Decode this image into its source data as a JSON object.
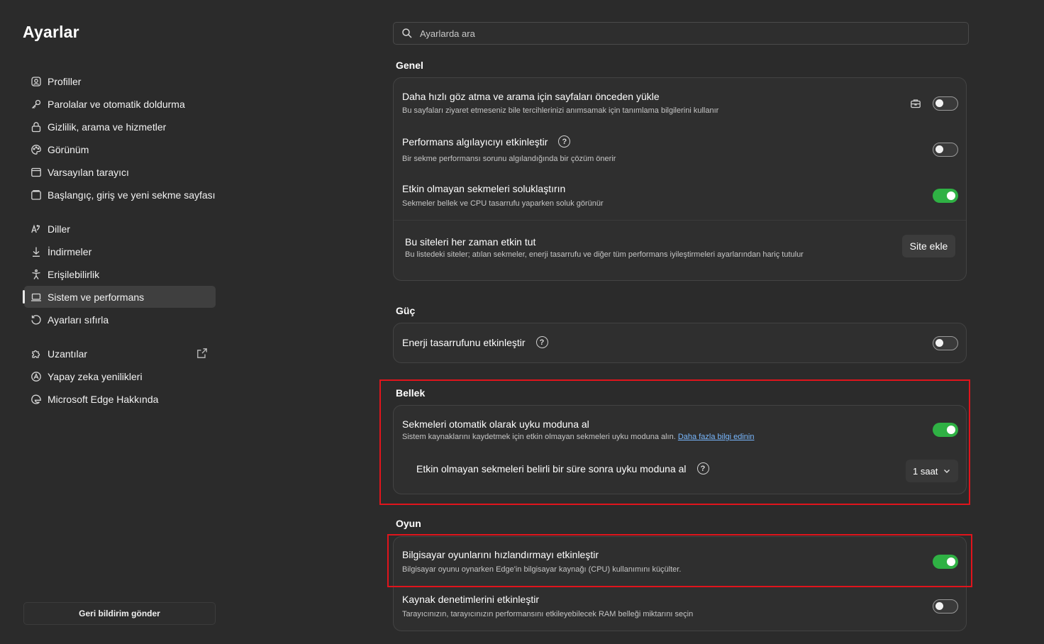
{
  "sidebar": {
    "title": "Ayarlar",
    "items": [
      {
        "label": "Profiller",
        "icon": "profile-icon"
      },
      {
        "label": "Parolalar ve otomatik doldurma",
        "icon": "key-icon"
      },
      {
        "label": "Gizlilik, arama ve hizmetler",
        "icon": "lock-icon"
      },
      {
        "label": "Görünüm",
        "icon": "palette-icon"
      },
      {
        "label": "Varsayılan tarayıcı",
        "icon": "browser-icon"
      },
      {
        "label": "Başlangıç, giriş ve yeni sekme sayfası",
        "icon": "home-tabs-icon"
      },
      {
        "label": "Diller",
        "icon": "language-icon"
      },
      {
        "label": "İndirmeler",
        "icon": "download-icon"
      },
      {
        "label": "Erişilebilirlik",
        "icon": "accessibility-icon"
      },
      {
        "label": "Sistem ve performans",
        "icon": "laptop-icon",
        "active": true
      },
      {
        "label": "Ayarları sıfırla",
        "icon": "reset-icon"
      },
      {
        "label": "Uzantılar",
        "icon": "puzzle-icon"
      },
      {
        "label": "Yapay zeka yenilikleri",
        "icon": "ai-icon"
      },
      {
        "label": "Microsoft Edge Hakkında",
        "icon": "edge-icon"
      }
    ],
    "feedback_label": "Geri bildirim gönder"
  },
  "search": {
    "placeholder": "Ayarlarda ara"
  },
  "sections": {
    "genel": {
      "title": "Genel",
      "preload": {
        "title": "Daha hızlı göz atma ve arama için sayfaları önceden yükle",
        "desc": "Bu sayfaları ziyaret etmeseniz bile tercihlerinizi anımsamak için tanımlama bilgilerini kullanır",
        "enabled": false
      },
      "perf_detector": {
        "title": "Performans algılayıcıyı etkinleştir",
        "desc": "Bir sekme performansı sorunu algılandığında bir çözüm önerir",
        "enabled": false
      },
      "fade_tabs": {
        "title": "Etkin olmayan sekmeleri soluklaştırın",
        "desc": "Sekmeler bellek ve CPU tasarrufu yaparken soluk görünür",
        "enabled": true
      },
      "always_active": {
        "title": "Bu siteleri her zaman etkin tut",
        "desc": "Bu listedeki siteler; atılan sekmeler, enerji tasarrufu ve diğer tüm performans iyileştirmeleri ayarlarından hariç tutulur",
        "button": "Site ekle"
      }
    },
    "guc": {
      "title": "Güç",
      "energy_saver": {
        "title": "Enerji tasarrufunu etkinleştir",
        "enabled": false
      }
    },
    "bellek": {
      "title": "Bellek",
      "sleeping_tabs": {
        "title": "Sekmeleri otomatik olarak uyku moduna al",
        "desc": "Sistem kaynaklarını kaydetmek için etkin olmayan sekmeleri uyku moduna alın.",
        "link": "Daha fazla bilgi edinin",
        "enabled": true
      },
      "sleep_after": {
        "title": "Etkin olmayan sekmeleri belirli bir süre sonra uyku moduna al",
        "value": "1 saat"
      }
    },
    "oyun": {
      "title": "Oyun",
      "pc_gaming": {
        "title": "Bilgisayar oyunlarını hızlandırmayı etkinleştir",
        "desc": "Bilgisayar oyunu oynarken Edge'in bilgisayar kaynağı (CPU) kullanımını küçülter.",
        "enabled": true
      },
      "resource_controls": {
        "title": "Kaynak denetimlerini etkinleştir",
        "desc": "Tarayıcınızın, tarayıcınızın performansını etkileyebilecek RAM belleği miktarını seçin",
        "enabled": false
      }
    }
  },
  "colors": {
    "accent_toggle_on": "#2fb144",
    "highlight_box": "#e0141c",
    "link": "#79b8ff"
  }
}
